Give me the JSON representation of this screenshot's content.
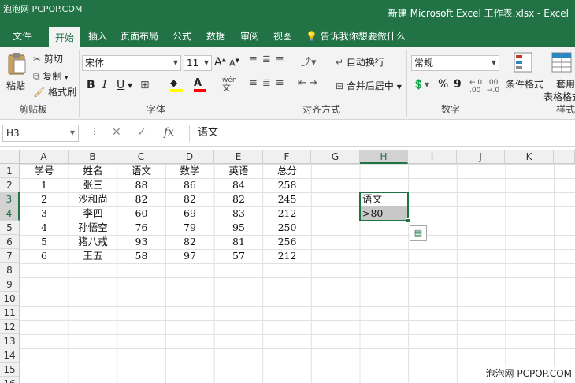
{
  "titlebar": {
    "watermark": "泡泡网 PCPOP.COM",
    "title": "新建 Microsoft Excel 工作表.xlsx  -  Excel"
  },
  "tabs": [
    "文件",
    "开始",
    "插入",
    "页面布局",
    "公式",
    "数据",
    "审阅",
    "视图"
  ],
  "tell_me": "告诉我你想要做什么",
  "ribbon": {
    "clipboard": {
      "paste": "粘贴",
      "cut": "剪切",
      "copy": "复制",
      "format_painter": "格式刷",
      "label": "剪贴板"
    },
    "font": {
      "name": "宋体",
      "size": "11",
      "grow": "A",
      "shrink": "A",
      "bold": "B",
      "italic": "I",
      "underline": "U",
      "wen": "wén",
      "label": "字体"
    },
    "alignment": {
      "wrap": "自动换行",
      "merge": "合并后居中",
      "label": "对齐方式"
    },
    "number": {
      "format": "常规",
      "percent": "%",
      "comma": "9",
      "label": "数字"
    },
    "styles": {
      "conditional": "条件格式",
      "table_format_1": "套用",
      "table_format_2": "表格格式",
      "label": "样式"
    }
  },
  "formula_bar": {
    "name_box": "H3",
    "fx": "fx",
    "content": "语文"
  },
  "columns": [
    "A",
    "B",
    "C",
    "D",
    "E",
    "F",
    "G",
    "H",
    "I",
    "J",
    "K"
  ],
  "rows": [
    "1",
    "2",
    "3",
    "4",
    "5",
    "6",
    "7",
    "8",
    "9",
    "10",
    "11",
    "12",
    "13",
    "14",
    "15",
    "16"
  ],
  "table": {
    "header": [
      "学号",
      "姓名",
      "语文",
      "数学",
      "英语",
      "总分"
    ],
    "data": [
      [
        "1",
        "张三",
        "88",
        "86",
        "84",
        "258"
      ],
      [
        "2",
        "沙和尚",
        "82",
        "82",
        "82",
        "245"
      ],
      [
        "3",
        "李四",
        "60",
        "69",
        "83",
        "212"
      ],
      [
        "4",
        "孙悟空",
        "76",
        "79",
        "95",
        "250"
      ],
      [
        "5",
        "猪八戒",
        "93",
        "82",
        "81",
        "256"
      ],
      [
        "6",
        "王五",
        "58",
        "97",
        "57",
        "212"
      ]
    ]
  },
  "criteria": {
    "h3": "语文",
    "h4": ">80"
  },
  "selected_cell": "H3",
  "watermark_bottom": "泡泡网 PCPOP.COM",
  "colors": {
    "accent": "#217346"
  }
}
